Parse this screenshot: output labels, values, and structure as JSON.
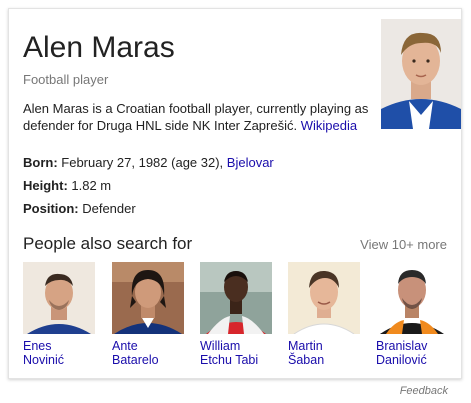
{
  "entity": {
    "name": "Alen Maras",
    "type": "Football player",
    "description": "Alen Maras is a Croatian football player, currently playing as defender for Druga HNL side NK Inter Zaprešić. ",
    "source_link": "Wikipedia",
    "facts": [
      {
        "label": "Born:",
        "value": " February 27, 1982 (age 32), ",
        "link": "Bjelovar"
      },
      {
        "label": "Height:",
        "value": " 1.82 m",
        "link": ""
      },
      {
        "label": "Position:",
        "value": " Defender",
        "link": ""
      }
    ]
  },
  "people_also_search": {
    "title": "People also search for",
    "more_label": "View 10+ more",
    "people": [
      {
        "first": "Enes",
        "last": "Novinić"
      },
      {
        "first": "Ante",
        "last": "Batarelo"
      },
      {
        "first": "William",
        "last": "Etchu Tabi"
      },
      {
        "first": "Martin",
        "last": "Šaban"
      },
      {
        "first": "Branislav",
        "last": "Danilović"
      }
    ]
  },
  "feedback_label": "Feedback",
  "colors": {
    "link": "#1a0dab",
    "muted": "#777777",
    "text": "#222222",
    "card_border": "#e3e3e3"
  }
}
